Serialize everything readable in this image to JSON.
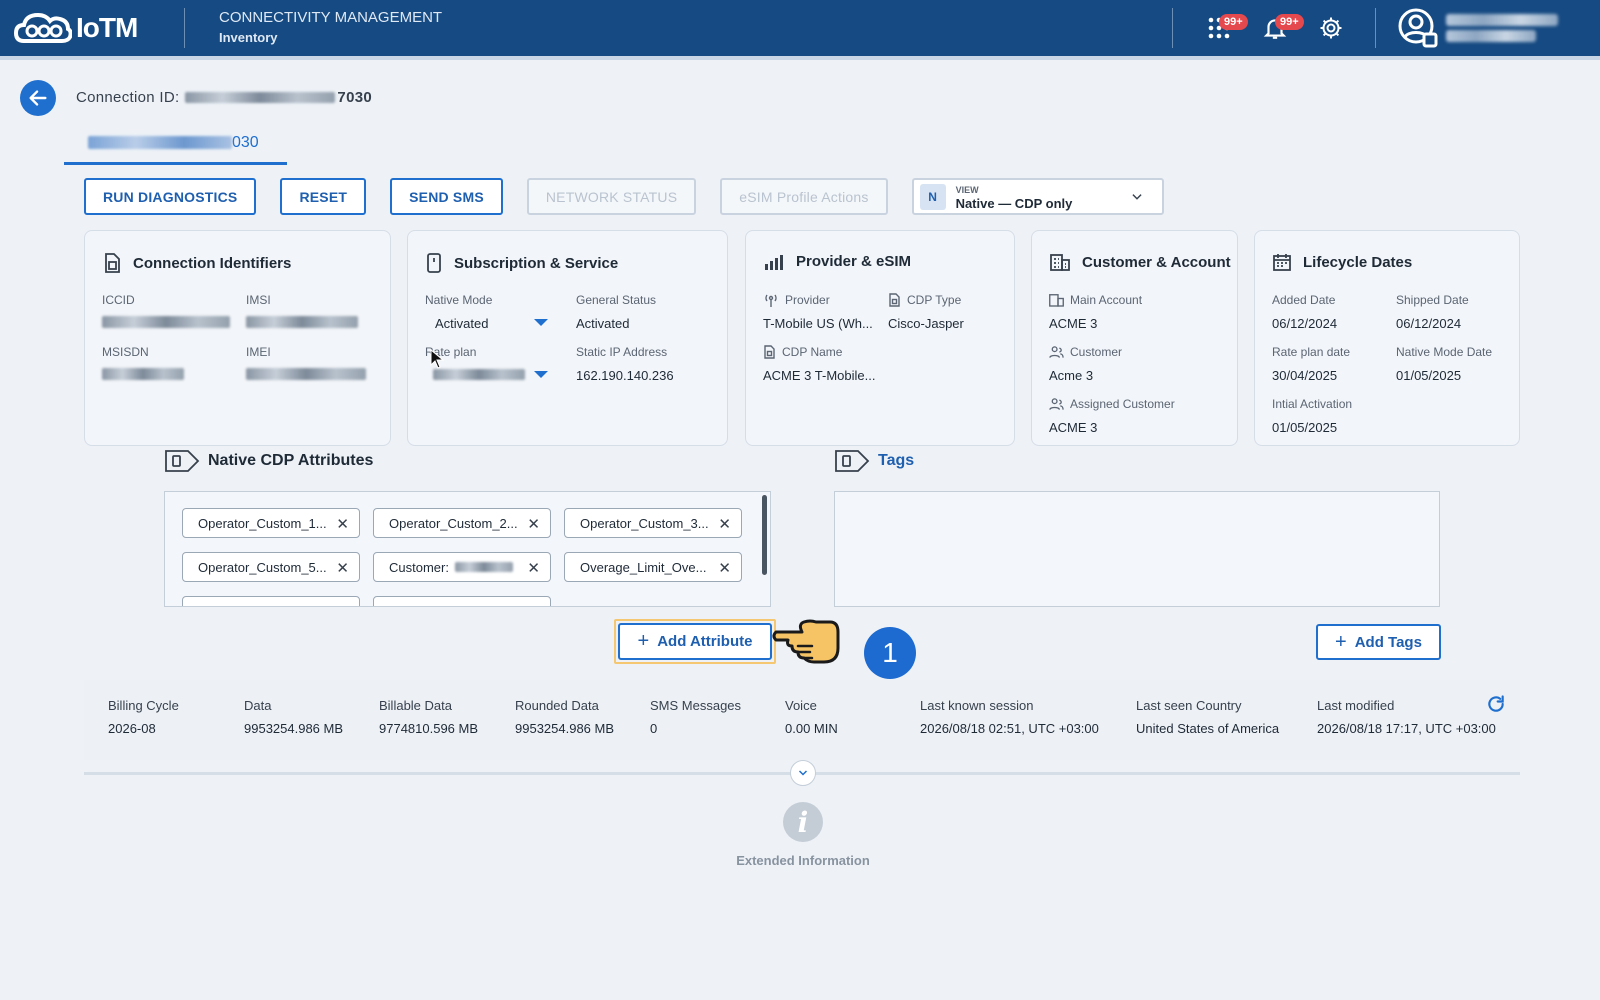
{
  "header": {
    "brand": "IoTM",
    "module_title": "CONNECTIVITY MANAGEMENT",
    "module_subtitle": "Inventory",
    "apps_badge": "99+",
    "notifications_badge": "99+"
  },
  "connection": {
    "label": "Connection ID:",
    "id_suffix": "7030",
    "tab_suffix": "030"
  },
  "actions": {
    "run_diagnostics": "RUN DIAGNOSTICS",
    "reset": "RESET",
    "send_sms": "SEND SMS",
    "network_status": "NETWORK STATUS",
    "esim_actions": "eSIM Profile Actions",
    "view_badge": "N",
    "view_label": "VIEW",
    "view_value": "Native — CDP only"
  },
  "cards": {
    "identifiers": {
      "title": "Connection Identifiers",
      "iccid": "ICCID",
      "imsi": "IMSI",
      "msisdn": "MSISDN",
      "imei": "IMEI"
    },
    "subscription": {
      "title": "Subscription & Service",
      "native_mode_label": "Native Mode",
      "native_mode_value": "Activated",
      "general_status_label": "General Status",
      "general_status_value": "Activated",
      "rate_plan_label": "Rate plan",
      "static_ip_label": "Static IP Address",
      "static_ip_value": "162.190.140.236"
    },
    "provider": {
      "title": "Provider & eSIM",
      "provider_label": "Provider",
      "provider_value": "T-Mobile US (Wh...",
      "cdp_type_label": "CDP Type",
      "cdp_type_value": "Cisco-Jasper",
      "cdp_name_label": "CDP Name",
      "cdp_name_value": "ACME 3 T-Mobile..."
    },
    "customer": {
      "title": "Customer & Account",
      "main_account_label": "Main Account",
      "main_account_value": "ACME 3",
      "customer_label": "Customer",
      "customer_value": "Acme 3",
      "assigned_label": "Assigned Customer",
      "assigned_value": "ACME 3"
    },
    "lifecycle": {
      "title": "Lifecycle Dates",
      "added_label": "Added Date",
      "added_value": "06/12/2024",
      "shipped_label": "Shipped Date",
      "shipped_value": "06/12/2024",
      "rate_plan_date_label": "Rate plan date",
      "rate_plan_date_value": "30/04/2025",
      "native_mode_date_label": "Native Mode Date",
      "native_mode_date_value": "01/05/2025",
      "initial_activation_label": "Intial Activation",
      "initial_activation_value": "01/05/2025"
    }
  },
  "attributes": {
    "title": "Native CDP Attributes",
    "chips": [
      "Operator_Custom_1...",
      "Operator_Custom_2...",
      "Operator_Custom_3...",
      "Operator_Custom_5...",
      "Customer:",
      "Overage_Limit_Ove..."
    ],
    "add_label": "Add Attribute"
  },
  "tags": {
    "title": "Tags",
    "add_label": "Add Tags"
  },
  "step_marker": "1",
  "stats": [
    {
      "label": "Billing Cycle",
      "value": "2026-08"
    },
    {
      "label": "Data",
      "value": "9953254.986 MB"
    },
    {
      "label": "Billable Data",
      "value": "9774810.596 MB"
    },
    {
      "label": "Rounded Data",
      "value": "9953254.986 MB"
    },
    {
      "label": "SMS Messages",
      "value": "0"
    },
    {
      "label": "Voice",
      "value": "0.00 MIN"
    },
    {
      "label": "Last known session",
      "value": "2026/08/18 02:51, UTC +03:00"
    },
    {
      "label": "Last seen Country",
      "value": "United States of America"
    },
    {
      "label": "Last modified",
      "value": "2026/08/18 17:17, UTC +03:00"
    }
  ],
  "extended_info": "Extended Information",
  "colors": {
    "header_bg": "#164a82",
    "accent": "#1f6fcf",
    "badge": "#e5484d",
    "highlight": "#f4c770"
  }
}
